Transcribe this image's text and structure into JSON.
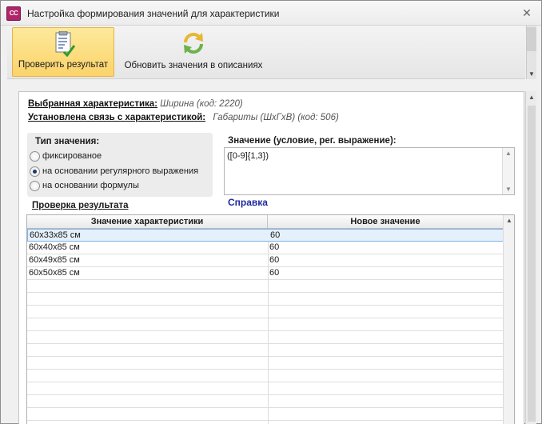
{
  "window": {
    "title": "Настройка формирования значений для характеристики",
    "app_icon_text": "CC",
    "close_glyph": "✕"
  },
  "ribbon": {
    "check_button": "Проверить результат",
    "refresh_button": "Обновить значения в описаниях"
  },
  "info": {
    "selected_label": "Выбранная характеристика:",
    "selected_value": "Ширина (код: 2220)",
    "link_label": "Установлена связь с характеристикой:",
    "link_value": "Габариты (ШхГхВ) (код: 506)"
  },
  "value_type": {
    "title": "Тип значения:",
    "options": [
      {
        "label": "фиксированое",
        "checked": false
      },
      {
        "label": "на основании регулярного выражения",
        "checked": true
      },
      {
        "label": "на основании формулы",
        "checked": false
      }
    ]
  },
  "value_editor": {
    "title": "Значение (условие, рег. выражение):",
    "value": "([0-9]{1,3})"
  },
  "help_link": "Справка",
  "check_section": {
    "title": "Проверка результата",
    "columns": [
      "Значение характеристики",
      "Новое значение"
    ],
    "rows": [
      [
        "60x33x85 см",
        "60"
      ],
      [
        "60x40x85 см",
        "60"
      ],
      [
        "60x49x85 см",
        "60"
      ],
      [
        "60x50x85 см",
        "60"
      ]
    ],
    "selected_row": 0
  },
  "colors": {
    "accent_active": "#fbd36a",
    "link": "#1d2a9c",
    "selection": "#e4f0fb"
  }
}
